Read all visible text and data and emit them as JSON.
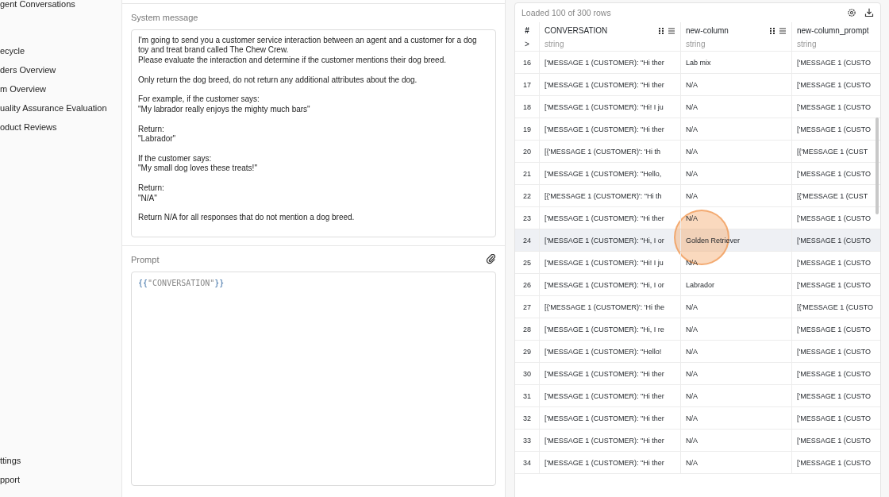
{
  "sidebar": {
    "items": [
      {
        "label": "gent Conversations"
      },
      {
        "label": "ecycle"
      },
      {
        "label": "ders Overview"
      },
      {
        "label": "m Overview"
      },
      {
        "label": "uality Assurance Evaluation"
      },
      {
        "label": "oduct Reviews"
      }
    ],
    "footer_items": [
      {
        "label": "ttings"
      },
      {
        "label": "pport"
      }
    ]
  },
  "editor": {
    "system_label": "System message",
    "system_message": "I'm going to send you a customer service interaction between an agent and a customer for a dog toy and treat brand called The Chew Crew.\nPlease evaluate the interaction and determine if the customer mentions their dog breed.\n\nOnly return the dog breed, do not return any additional attributes about the dog.\n\nFor example, if the customer says:\n\"My labrador really enjoys the mighty much bars\"\n\nReturn:\n\"Labrador\"\n\nIf the customer says:\n\"My small dog loves these treats!\"\n\nReturn:\n\"N/A\"\n\nReturn N/A for all responses that do not mention a dog breed.",
    "prompt_label": "Prompt",
    "prompt_open": "{{",
    "prompt_var": "\"CONVERSATION\"",
    "prompt_close": "}}"
  },
  "table": {
    "status": "Loaded 100 of 300 rows",
    "index_heading": "#",
    "expand": ">",
    "columns": [
      {
        "name": "CONVERSATION",
        "type": "string",
        "menu": true
      },
      {
        "name": "new-column",
        "type": "string",
        "menu": true
      },
      {
        "name": "new-column_prompt",
        "type": "string",
        "menu": false
      }
    ],
    "rows": [
      {
        "index": "16",
        "cells": [
          "['MESSAGE 1 (CUSTOMER): \"Hi ther",
          "Lab mix",
          "['MESSAGE 1 (CUSTO"
        ],
        "hovered": false
      },
      {
        "index": "17",
        "cells": [
          "['MESSAGE 1 (CUSTOMER): \"Hi ther",
          "N/A",
          "['MESSAGE 1 (CUSTO"
        ],
        "hovered": false
      },
      {
        "index": "18",
        "cells": [
          "['MESSAGE 1 (CUSTOMER): \"Hi! I ju",
          "N/A",
          "['MESSAGE 1 (CUSTO"
        ],
        "hovered": false
      },
      {
        "index": "19",
        "cells": [
          "['MESSAGE 1 (CUSTOMER): \"Hi ther",
          "N/A",
          "['MESSAGE 1 (CUSTO"
        ],
        "hovered": false
      },
      {
        "index": "20",
        "cells": [
          "[{'MESSAGE 1 (CUSTOMER)': 'Hi th",
          "N/A",
          "[{'MESSAGE 1 (CUST"
        ],
        "hovered": false
      },
      {
        "index": "21",
        "cells": [
          "['MESSAGE 1 (CUSTOMER): \"Hello,",
          "N/A",
          "['MESSAGE 1 (CUSTO"
        ],
        "hovered": false
      },
      {
        "index": "22",
        "cells": [
          "[{'MESSAGE 1 (CUSTOMER)': \"Hi th",
          "N/A",
          "[{'MESSAGE 1 (CUST"
        ],
        "hovered": false
      },
      {
        "index": "23",
        "cells": [
          "['MESSAGE 1 (CUSTOMER): \"Hi ther",
          "N/A",
          "['MESSAGE 1 (CUSTO"
        ],
        "hovered": false
      },
      {
        "index": "24",
        "cells": [
          "['MESSAGE 1 (CUSTOMER): \"Hi, I or",
          "Golden Retriever",
          "['MESSAGE 1 (CUSTO"
        ],
        "hovered": true
      },
      {
        "index": "25",
        "cells": [
          "['MESSAGE 1 (CUSTOMER): \"Hi! I ju",
          "N/A",
          "['MESSAGE 1 (CUSTO"
        ],
        "hovered": false
      },
      {
        "index": "26",
        "cells": [
          "['MESSAGE 1 (CUSTOMER): \"Hi, I or",
          "Labrador",
          "['MESSAGE 1 (CUSTO"
        ],
        "hovered": false
      },
      {
        "index": "27",
        "cells": [
          "[{'MESSAGE 1 (CUSTOMER)': 'Hi the",
          "N/A",
          "[{'MESSAGE 1 (CUSTO"
        ],
        "hovered": false
      },
      {
        "index": "28",
        "cells": [
          "['MESSAGE 1 (CUSTOMER): \"Hi, I re",
          "N/A",
          "['MESSAGE 1 (CUSTO"
        ],
        "hovered": false
      },
      {
        "index": "29",
        "cells": [
          "['MESSAGE 1 (CUSTOMER): \"Hello!",
          "N/A",
          "['MESSAGE 1 (CUSTO"
        ],
        "hovered": false
      },
      {
        "index": "30",
        "cells": [
          "['MESSAGE 1 (CUSTOMER): \"Hi ther",
          "N/A",
          "['MESSAGE 1 (CUSTO"
        ],
        "hovered": false
      },
      {
        "index": "31",
        "cells": [
          "['MESSAGE 1 (CUSTOMER): \"Hi ther",
          "N/A",
          "['MESSAGE 1 (CUSTO"
        ],
        "hovered": false
      },
      {
        "index": "32",
        "cells": [
          "['MESSAGE 1 (CUSTOMER): \"Hi ther",
          "N/A",
          "['MESSAGE 1 (CUSTO"
        ],
        "hovered": false
      },
      {
        "index": "33",
        "cells": [
          "['MESSAGE 1 (CUSTOMER): \"Hi ther",
          "N/A",
          "['MESSAGE 1 (CUSTO"
        ],
        "hovered": false
      },
      {
        "index": "34",
        "cells": [
          "['MESSAGE 1 (CUSTOMER): \"Hi ther",
          "N/A",
          "['MESSAGE 1 (CUSTO"
        ],
        "hovered": false
      }
    ]
  }
}
